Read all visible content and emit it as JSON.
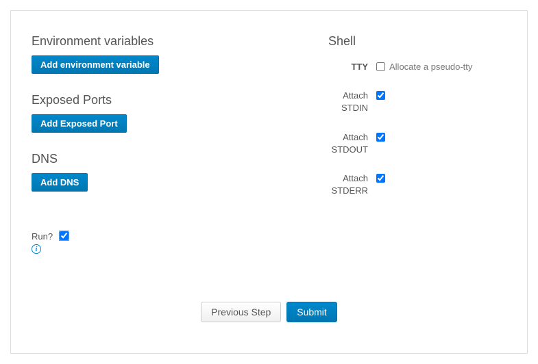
{
  "left": {
    "env": {
      "heading": "Environment variables",
      "add_button": "Add environment variable"
    },
    "ports": {
      "heading": "Exposed Ports",
      "add_button": "Add Exposed Port"
    },
    "dns": {
      "heading": "DNS",
      "add_button": "Add DNS"
    },
    "run": {
      "label": "Run?",
      "checked": true
    }
  },
  "right": {
    "heading": "Shell",
    "tty": {
      "label": "TTY",
      "desc": "Allocate a pseudo-tty",
      "checked": false
    },
    "stdin": {
      "label": "Attach STDIN",
      "checked": true
    },
    "stdout": {
      "label": "Attach STDOUT",
      "checked": true
    },
    "stderr": {
      "label": "Attach STDERR",
      "checked": true
    }
  },
  "footer": {
    "previous": "Previous Step",
    "submit": "Submit"
  }
}
